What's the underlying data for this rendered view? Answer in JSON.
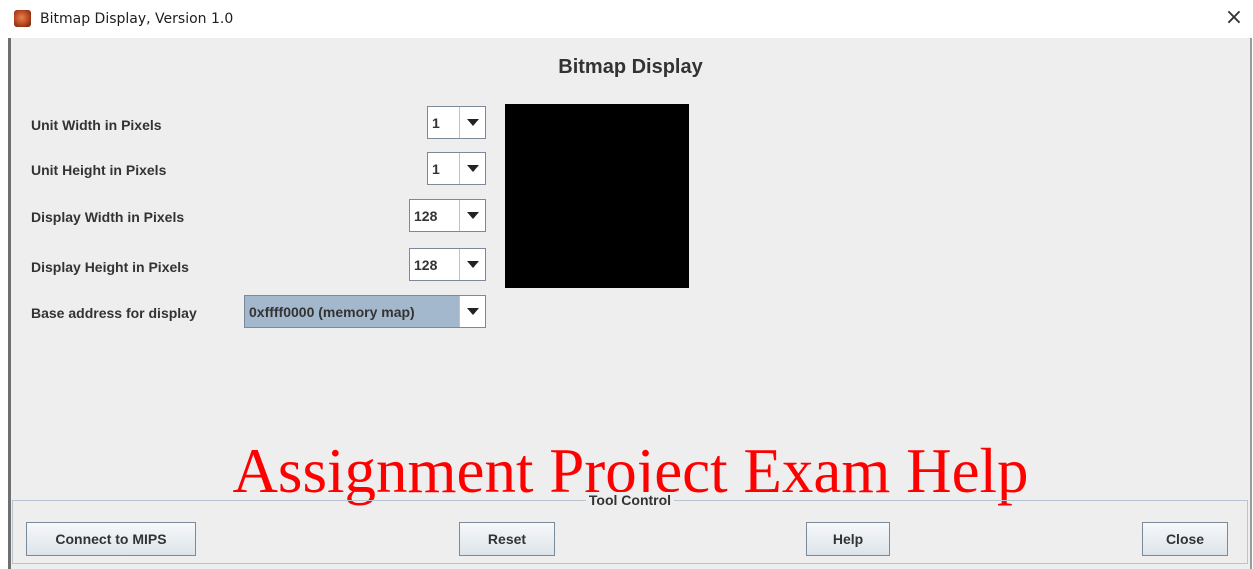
{
  "window": {
    "title": "Bitmap Display, Version 1.0",
    "icon": "mars-app-icon",
    "close_glyph": "×"
  },
  "panel": {
    "heading": "Bitmap Display",
    "settings": [
      {
        "label": "Unit Width in Pixels",
        "value": "1"
      },
      {
        "label": "Unit Height in Pixels",
        "value": "1"
      },
      {
        "label": "Display Width in Pixels",
        "value": "128"
      },
      {
        "label": "Display Height in Pixels",
        "value": "128"
      },
      {
        "label": "Base address for display",
        "value": "0xffff0000 (memory map)"
      }
    ],
    "display_color": "#000000"
  },
  "tool_control": {
    "title": "Tool Control",
    "buttons": {
      "connect": "Connect to MIPS",
      "reset": "Reset",
      "help": "Help",
      "close": "Close"
    }
  },
  "watermark": "Assignment Project Exam Help"
}
